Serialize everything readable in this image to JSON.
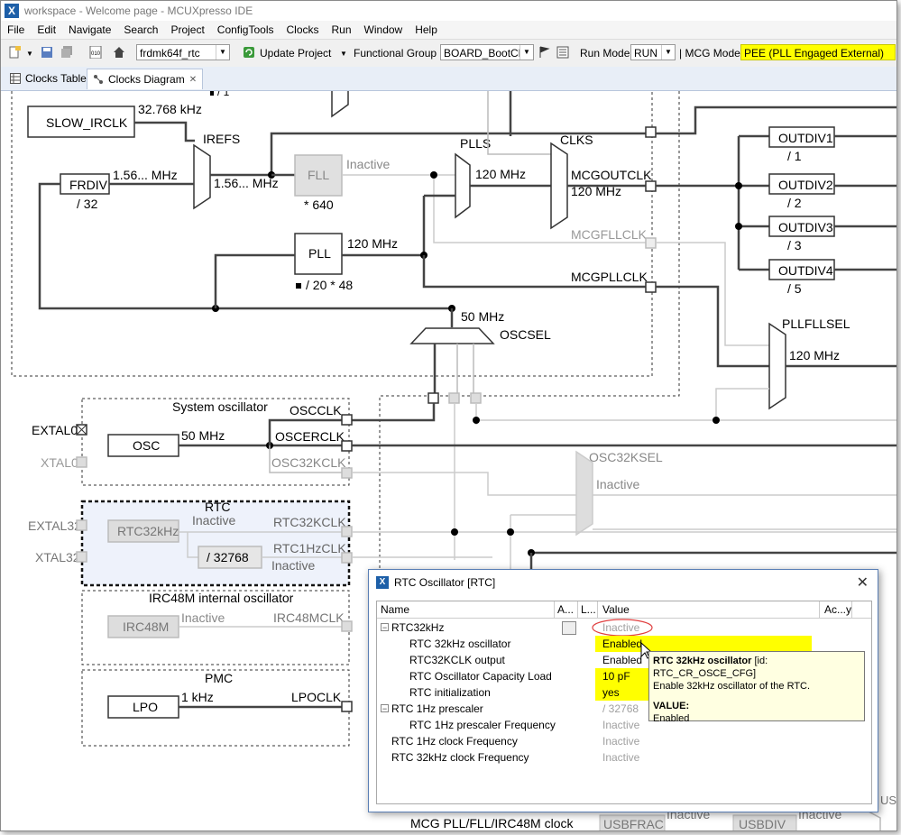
{
  "window": {
    "title": "workspace - Welcome page - MCUXpresso IDE"
  },
  "menu": [
    "File",
    "Edit",
    "Navigate",
    "Search",
    "Project",
    "ConfigTools",
    "Clocks",
    "Run",
    "Window",
    "Help"
  ],
  "toolbar": {
    "project": "frdmk64f_rtc",
    "update_project": "Update Project",
    "functional_group_label": "Functional Group",
    "functional_group": "BOARD_BootClo",
    "run_mode_label": "Run Mode",
    "run_mode": "RUN",
    "mcg_mode_label": "| MCG Mode",
    "mcg_mode": "PEE (PLL Engaged External)",
    "accent": "#ffff00"
  },
  "tabs": [
    {
      "label": "Clocks Table"
    },
    {
      "label": "Clocks Diagram",
      "close": "✕"
    }
  ],
  "diagram": {
    "slow_irclk": "SLOW_IRCLK",
    "slow_freq": "32.768 kHz",
    "irefs": "IREFS",
    "frdiv": "FRDIV",
    "frdiv_div": "/ 32",
    "frdiv_freq": "1.56... MHz",
    "irefs_out_freq": "1.56... MHz",
    "fll": "FLL",
    "fll_status": "Inactive",
    "fll_mult": "* 640",
    "plls": "PLLS",
    "plls_freq": "120 MHz",
    "clks": "CLKS",
    "mcgoutclk": "MCGOUTCLK",
    "mcgoutclk_freq": "120 MHz",
    "mcgfllclk": "MCGFLLCLK",
    "mcgpllclk": "MCGPLLCLK",
    "pll": "PLL",
    "pll_freq": "120 MHz",
    "pll_div": "/ 20 * 48",
    "osc_50": "50 MHz",
    "oscsel": "OSCSEL",
    "outdiv1": "OUTDIV1",
    "outdiv1_d": "/ 1",
    "outdiv2": "OUTDIV2",
    "outdiv2_d": "/ 2",
    "outdiv3": "OUTDIV3",
    "outdiv3_d": "/ 3",
    "outdiv4": "OUTDIV4",
    "outdiv4_d": "/ 5",
    "pllfllsel": "PLLFLLSEL",
    "pllfllsel_freq": "120 MHz",
    "system_oscillator": "System oscillator",
    "extal0": "EXTAL0",
    "xtal0": "XTAL0",
    "osc": "OSC",
    "osc_freq": "50 MHz",
    "oscclk": "OSCCLK",
    "oscerclk": "OSCERCLK",
    "osc32kclk": "OSC32KCLK",
    "osc32ksel": "OSC32KSEL",
    "osc32ksel_status": "Inactive",
    "rtc": "RTC",
    "extal32": "EXTAL32",
    "xtal32": "XTAL32",
    "rtc32khz": "RTC32kHz",
    "rtc_inactive": "Inactive",
    "rtc32kclk": "RTC32KCLK",
    "rtc1hzclk": "RTC1HzCLK",
    "rtc1hz_inactive": "Inactive",
    "rtc_div": "/ 32768",
    "irc48m_section": "IRC48M internal oscillator",
    "irc48m": "IRC48M",
    "irc48m_status": "Inactive",
    "irc48mclk": "IRC48MCLK",
    "pmc": "PMC",
    "lpo": "LPO",
    "lpo_freq": "1 kHz",
    "lpoclk": "LPOCLK",
    "mcg_bottom": "MCG PLL/FLL/IRC48M clock",
    "usbfrac": "USBFRAC",
    "usbfrac_status": "Inactive",
    "usbdiv": "USBDIV",
    "usbdiv_status": "Inactive",
    "us_fragment": "US"
  },
  "popup": {
    "title": "RTC Oscillator [RTC]",
    "headers": {
      "name": "Name",
      "a": "A...",
      "l": "L...",
      "value": "Value",
      "acy": "Ac...y"
    },
    "rows": [
      {
        "name": "RTC32kHz",
        "value": "Inactive"
      },
      {
        "name": "RTC 32kHz oscillator",
        "value": "Enabled"
      },
      {
        "name": "RTC32KCLK output",
        "value": "Enabled"
      },
      {
        "name": "RTC Oscillator Capacity Load",
        "value": "10 pF"
      },
      {
        "name": "RTC initialization",
        "value": "yes"
      },
      {
        "name": "RTC 1Hz prescaler",
        "value": "/ 32768"
      },
      {
        "name": "RTC 1Hz prescaler Frequency",
        "value": "Inactive"
      },
      {
        "name": "RTC 1Hz clock Frequency",
        "value": "Inactive"
      },
      {
        "name": "RTC 32kHz clock Frequency",
        "value": "Inactive"
      }
    ]
  },
  "tooltip": {
    "title": "RTC 32kHz oscillator",
    "id": "[id: RTC_CR_OSCE_CFG]",
    "desc": "Enable 32kHz oscillator of the RTC.",
    "value_label": "VALUE:",
    "value": "Enabled"
  }
}
